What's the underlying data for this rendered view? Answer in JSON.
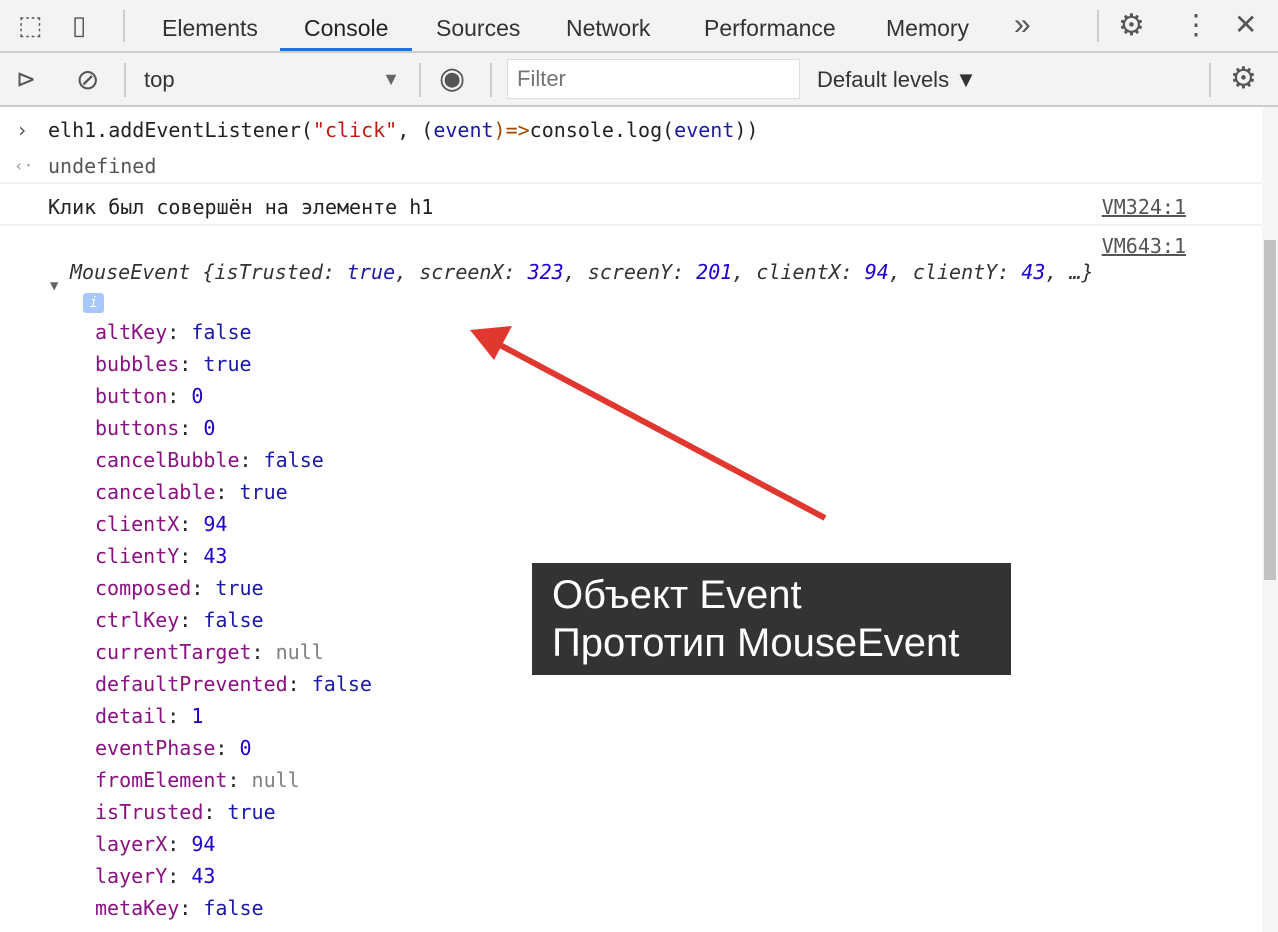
{
  "tabs": [
    "Elements",
    "Console",
    "Sources",
    "Network",
    "Performance",
    "Memory"
  ],
  "more_tabs": "»",
  "context": "top",
  "filter_placeholder": "Filter",
  "levels": "Default levels ▼",
  "console": {
    "input": {
      "prefix": "elh1.addEventListener(",
      "str": "\"click\"",
      "mid": ", (",
      "param": "event",
      "arrow": ")=>",
      "call": "console.log(",
      "param2": "event",
      "end": "))"
    },
    "result": "undefined",
    "log1": {
      "text": "Клик был совершён на элементе h1",
      "source": "VM324:1"
    },
    "log2": {
      "source": "VM643:1",
      "summary": [
        [
          "MouseEvent {",
          ""
        ],
        [
          "isTrusted: ",
          "true"
        ],
        [
          ", screenX: ",
          "323"
        ],
        [
          ", screenY: ",
          "201"
        ],
        [
          ", clientX: ",
          "94"
        ],
        [
          ", clientY: ",
          "43"
        ],
        [
          ", …}",
          ""
        ]
      ]
    },
    "properties": [
      {
        "key": "altKey",
        "value": "false",
        "type": "b"
      },
      {
        "key": "bubbles",
        "value": "true",
        "type": "b"
      },
      {
        "key": "button",
        "value": "0",
        "type": "n"
      },
      {
        "key": "buttons",
        "value": "0",
        "type": "n"
      },
      {
        "key": "cancelBubble",
        "value": "false",
        "type": "b"
      },
      {
        "key": "cancelable",
        "value": "true",
        "type": "b"
      },
      {
        "key": "clientX",
        "value": "94",
        "type": "n"
      },
      {
        "key": "clientY",
        "value": "43",
        "type": "n"
      },
      {
        "key": "composed",
        "value": "true",
        "type": "b"
      },
      {
        "key": "ctrlKey",
        "value": "false",
        "type": "b"
      },
      {
        "key": "currentTarget",
        "value": "null",
        "type": "nl"
      },
      {
        "key": "defaultPrevented",
        "value": "false",
        "type": "b"
      },
      {
        "key": "detail",
        "value": "1",
        "type": "n"
      },
      {
        "key": "eventPhase",
        "value": "0",
        "type": "n"
      },
      {
        "key": "fromElement",
        "value": "null",
        "type": "nl"
      },
      {
        "key": "isTrusted",
        "value": "true",
        "type": "b"
      },
      {
        "key": "layerX",
        "value": "94",
        "type": "n"
      },
      {
        "key": "layerY",
        "value": "43",
        "type": "n"
      },
      {
        "key": "metaKey",
        "value": "false",
        "type": "b"
      }
    ]
  },
  "annotation": {
    "line1": "Объект Event",
    "line2": "Прототип MouseEvent"
  },
  "colors": {
    "accent": "#1a73e8",
    "arrow": "#e0382e"
  }
}
